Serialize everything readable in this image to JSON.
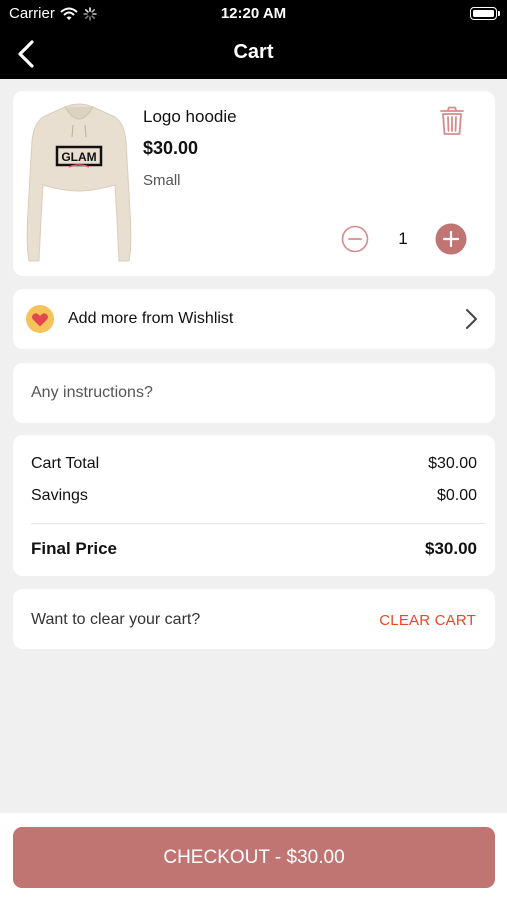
{
  "status_bar": {
    "carrier": "Carrier",
    "time": "12:20 AM"
  },
  "nav": {
    "title": "Cart",
    "back_icon": "chevron-left-icon"
  },
  "cart_item": {
    "image_text": "GLAM",
    "name": "Logo hoodie",
    "price": "$30.00",
    "size": "Small",
    "quantity": "1",
    "delete_icon": "trash-icon"
  },
  "wishlist": {
    "label": "Add more from Wishlist",
    "icon": "heart-icon"
  },
  "instructions": {
    "placeholder": "Any instructions?"
  },
  "summary": {
    "cart_total_label": "Cart Total",
    "cart_total_value": "$30.00",
    "savings_label": "Savings",
    "savings_value": "$0.00",
    "final_price_label": "Final Price",
    "final_price_value": "$30.00"
  },
  "clear": {
    "question": "Want to clear your cart?",
    "button_label": "CLEAR CART"
  },
  "checkout": {
    "label": "CHECKOUT - $30.00"
  },
  "colors": {
    "accent": "#c07573",
    "clear_text": "#e9462a",
    "background": "#f0f0f0",
    "header": "#000000"
  }
}
